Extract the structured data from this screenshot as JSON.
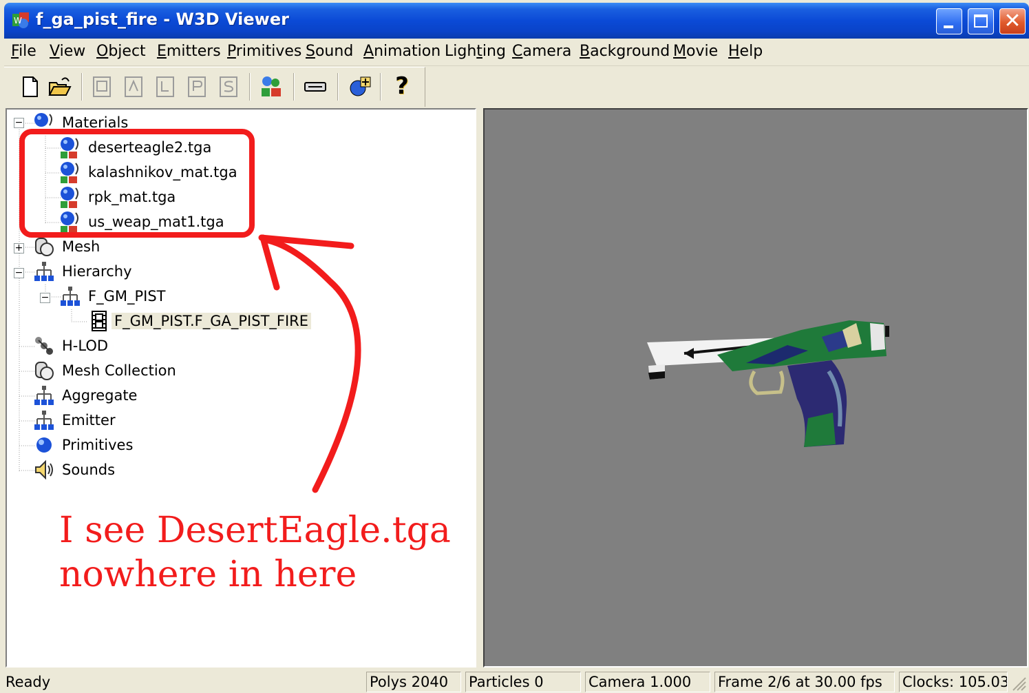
{
  "window": {
    "title": "f_ga_pist_fire - W3D Viewer",
    "colors": {
      "titlebar": "#0b4ad6",
      "face": "#ece9d8",
      "viewport": "#808080",
      "annotation": "#f21c1c"
    }
  },
  "menu": [
    {
      "key": "F",
      "rest": "ile"
    },
    {
      "key": "V",
      "rest": "iew"
    },
    {
      "key": "O",
      "rest": "bject"
    },
    {
      "key": "E",
      "rest": "mitters"
    },
    {
      "key": "P",
      "rest": "rimitives"
    },
    {
      "key": "S",
      "rest": "ound"
    },
    {
      "key": "A",
      "rest": "nimation"
    },
    {
      "pre": "Ligh",
      "key": "t",
      "rest": "ing"
    },
    {
      "key": "C",
      "rest": "amera"
    },
    {
      "key": "B",
      "rest": "ackground"
    },
    {
      "key": "M",
      "rest": "ovie"
    },
    {
      "key": "H",
      "rest": "elp"
    }
  ],
  "toolbar": {
    "icons": [
      "new-file-icon",
      "open-folder-icon",
      "view-front-icon",
      "view-back-icon",
      "view-left-icon",
      "view-right-icon",
      "view-top-icon",
      "object-icon",
      "keyboard-icon",
      "add-object-icon",
      "help-icon"
    ],
    "help_glyph": "?"
  },
  "tree": {
    "materials": {
      "label": "Materials",
      "items": [
        "deserteagle2.tga",
        "kalashnikov_mat.tga",
        "rpk_mat.tga",
        "us_weap_mat1.tga"
      ]
    },
    "mesh": "Mesh",
    "hierarchy": {
      "label": "Hierarchy",
      "child": "F_GM_PIST",
      "grandchild": "F_GM_PIST.F_GA_PIST_FIRE"
    },
    "others": [
      "H-LOD",
      "Mesh Collection",
      "Aggregate",
      "Emitter",
      "Primitives",
      "Sounds"
    ],
    "expanders": {
      "collapse": "−",
      "expand": "+"
    }
  },
  "annotation": {
    "line1": "I see DesertEagle.tga",
    "line2": "nowhere in here"
  },
  "status": {
    "ready": "Ready",
    "polys": "Polys 2040",
    "particles": "Particles 0",
    "camera": "Camera 1.000",
    "frame": "Frame 2/6 at 30.00 fps",
    "clocks": "Clocks: 105.03"
  }
}
